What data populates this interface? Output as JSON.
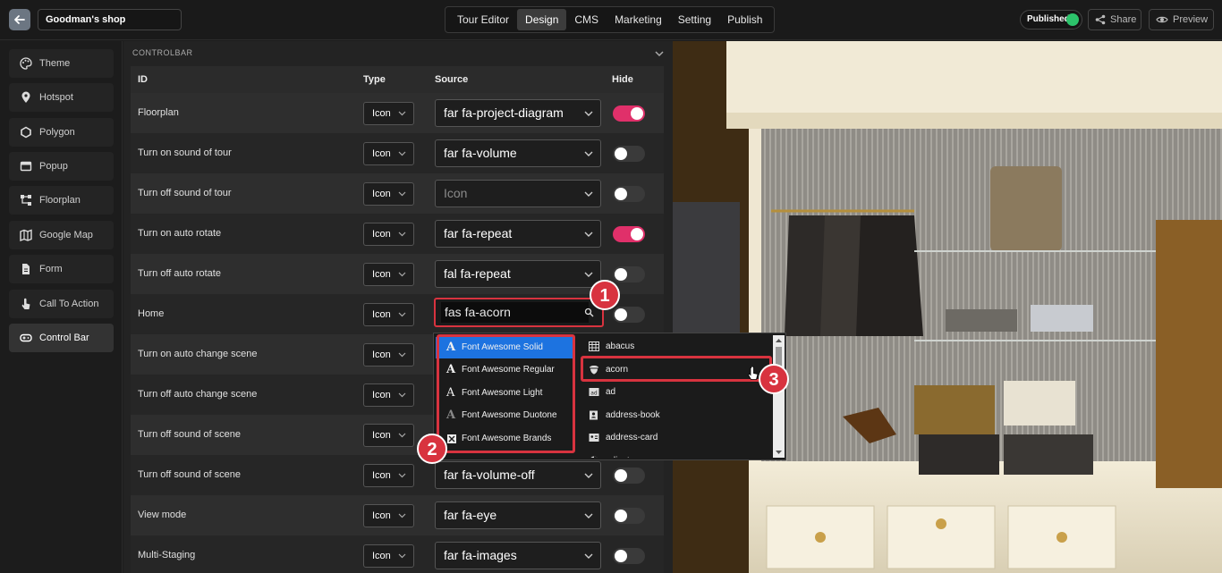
{
  "header": {
    "shop_name": "Goodman's shop",
    "tabs": [
      "Tour Editor",
      "Design",
      "CMS",
      "Marketing",
      "Setting",
      "Publish"
    ],
    "active_tab": "Design",
    "published_label": "Published",
    "share_label": "Share",
    "preview_label": "Preview",
    "status_color": "#2cc36b"
  },
  "sidebar": {
    "items": [
      {
        "label": "Theme",
        "icon": "palette-icon"
      },
      {
        "label": "Hotspot",
        "icon": "map-pin-icon"
      },
      {
        "label": "Polygon",
        "icon": "polygon-icon"
      },
      {
        "label": "Popup",
        "icon": "window-icon"
      },
      {
        "label": "Floorplan",
        "icon": "floorplan-icon"
      },
      {
        "label": "Google Map",
        "icon": "map-icon"
      },
      {
        "label": "Form",
        "icon": "document-icon"
      },
      {
        "label": "Call To Action",
        "icon": "pointer-icon"
      },
      {
        "label": "Control Bar",
        "icon": "gamepad-icon"
      }
    ],
    "active_item": "Control Bar"
  },
  "controlbar": {
    "section_title": "CONTROLBAR",
    "columns": {
      "id": "ID",
      "type": "Type",
      "source": "Source",
      "hide": "Hide"
    },
    "rows": [
      {
        "id": "Floorplan",
        "type": "Icon",
        "source": "far fa-project-diagram",
        "hide": true
      },
      {
        "id": "Turn on sound of tour",
        "type": "Icon",
        "source": "far fa-volume",
        "hide": false
      },
      {
        "id": "Turn off sound of tour",
        "type": "Icon",
        "source": "Icon",
        "source_placeholder": true,
        "hide": false
      },
      {
        "id": "Turn on auto rotate",
        "type": "Icon",
        "source": "far fa-repeat",
        "hide": true
      },
      {
        "id": "Turn off auto rotate",
        "type": "Icon",
        "source": "fal fa-repeat",
        "hide": false
      },
      {
        "id": "Home",
        "type": "Icon",
        "source": "fas fa-acorn",
        "hide": false
      },
      {
        "id": "Turn on auto change scene",
        "type": "Icon",
        "source": "",
        "hide": false
      },
      {
        "id": "Turn off auto change scene",
        "type": "Icon",
        "source": "",
        "hide": false
      },
      {
        "id": "Turn off sound of scene",
        "type": "Icon",
        "source": "",
        "hide": false
      },
      {
        "id": "Turn off sound of scene",
        "type": "Icon",
        "source": "far fa-volume-off",
        "hide": false
      },
      {
        "id": "View mode",
        "type": "Icon",
        "source": "far fa-eye",
        "hide": false
      },
      {
        "id": "Multi-Staging",
        "type": "Icon",
        "source": "far fa-images",
        "hide": false
      }
    ],
    "toggle_on_color": "#e0306a"
  },
  "icon_picker": {
    "search_value": "fas fa-acorn",
    "libraries": [
      {
        "label": "Font Awesome Solid",
        "active": true
      },
      {
        "label": "Font Awesome Regular",
        "active": false
      },
      {
        "label": "Font Awesome Light",
        "active": false
      },
      {
        "label": "Font Awesome Duotone",
        "active": false
      },
      {
        "label": "Font Awesome Brands",
        "active": false
      }
    ],
    "icons": [
      {
        "label": "abacus",
        "icon": "abacus-icon"
      },
      {
        "label": "acorn",
        "icon": "acorn-icon"
      },
      {
        "label": "ad",
        "icon": "ad-icon"
      },
      {
        "label": "address-book",
        "icon": "address-book-icon"
      },
      {
        "label": "address-card",
        "icon": "address-card-icon"
      },
      {
        "label": "adjust",
        "icon": "adjust-icon"
      }
    ],
    "selected_icon": "acorn"
  },
  "annotations": {
    "badges": [
      "1",
      "2",
      "3"
    ],
    "color": "#d8333f"
  }
}
